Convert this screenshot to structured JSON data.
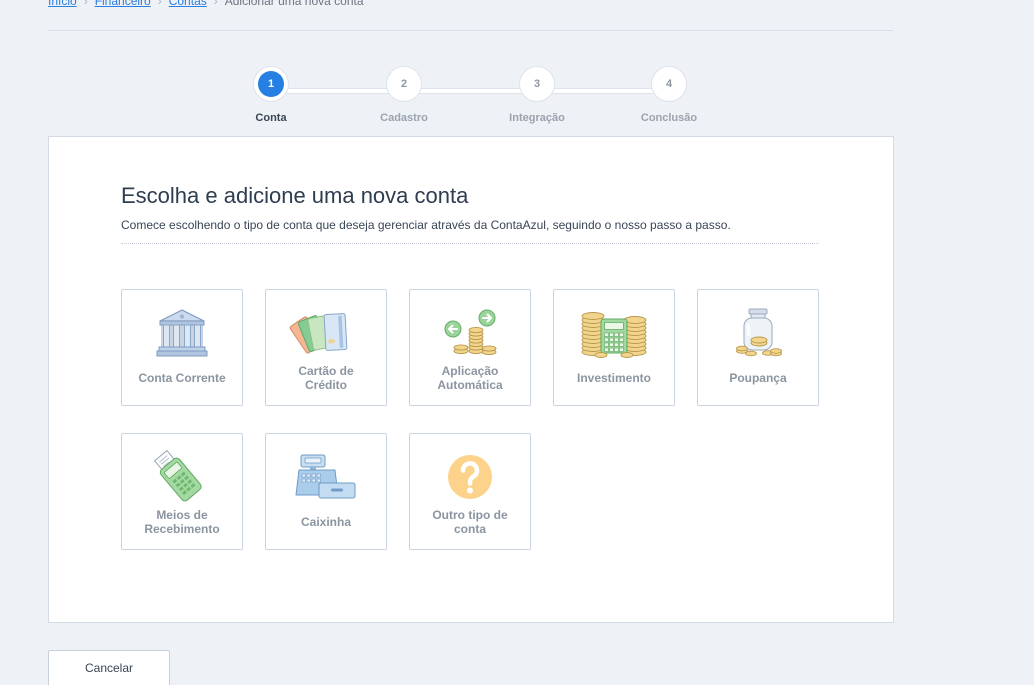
{
  "breadcrumb": {
    "items": [
      "Início",
      "Financeiro",
      "Contas"
    ],
    "current": "Adicionar uma nova conta",
    "separator": "›"
  },
  "stepper": {
    "steps": [
      {
        "number": "1",
        "label": "Conta",
        "state": "active"
      },
      {
        "number": "2",
        "label": "Cadastro",
        "state": "pending"
      },
      {
        "number": "3",
        "label": "Integração",
        "state": "pending"
      },
      {
        "number": "4",
        "label": "Conclusão",
        "state": "pending"
      }
    ]
  },
  "main": {
    "title": "Escolha e adicione uma nova conta",
    "subtitle": "Comece escolhendo o tipo de conta que deseja gerenciar através da ContaAzul, seguindo o nosso passo a passo.",
    "account_types": [
      {
        "label": [
          "Conta Corrente"
        ],
        "icon": "bank-icon"
      },
      {
        "label": [
          "Cartão de",
          "Crédito"
        ],
        "icon": "credit-cards-icon"
      },
      {
        "label": [
          "Aplicação",
          "Automática"
        ],
        "icon": "coins-arrows-icon"
      },
      {
        "label": [
          "Investimento"
        ],
        "icon": "coins-calculator-icon"
      },
      {
        "label": [
          "Poupança"
        ],
        "icon": "coin-jar-icon"
      },
      {
        "label": [
          "Meios de",
          "Recebimento"
        ],
        "icon": "card-machine-icon"
      },
      {
        "label": [
          "Caixinha"
        ],
        "icon": "cash-register-icon"
      },
      {
        "label": [
          "Outro tipo de",
          "conta"
        ],
        "icon": "question-mark-icon"
      }
    ]
  },
  "footer": {
    "cancel_label": "Cancelar"
  },
  "colors": {
    "page_background": "#eef1f6",
    "accent": "#2680e3",
    "link": "#2a7de1",
    "card_background": "#ffffff",
    "tile_border": "#cbd4df",
    "tile_label": "#8b95a1",
    "title_text": "#2e3d4f"
  }
}
